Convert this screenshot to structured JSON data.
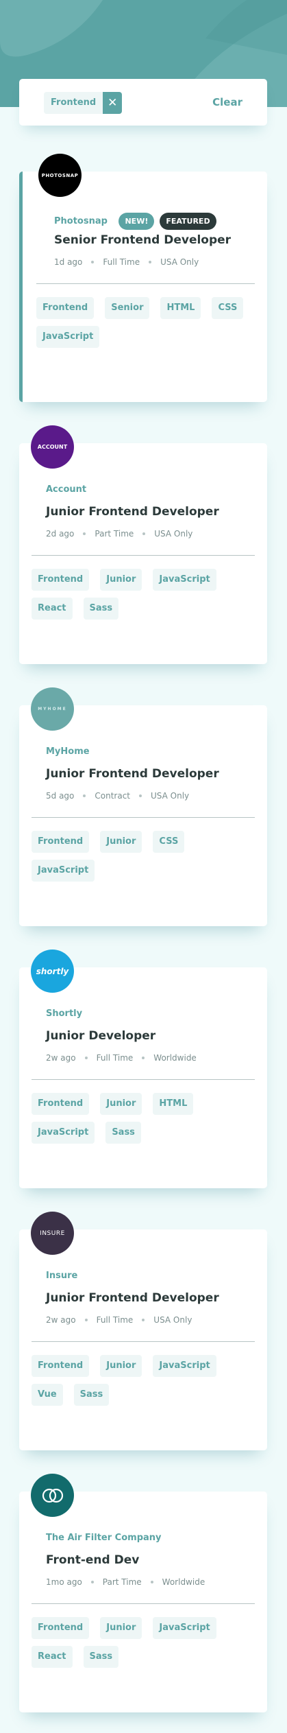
{
  "colors": {
    "primary": "#5ba4a4",
    "bg": "#effafa",
    "dark": "#2c3a3a",
    "gray": "#7b8e8e"
  },
  "filter": {
    "chips": [
      {
        "label": "Frontend",
        "remove_icon": "close-icon"
      }
    ],
    "clear_label": "Clear"
  },
  "jobs": [
    {
      "company": "Photosnap",
      "logo_text": "PHOTOSNAP",
      "new": "NEW!",
      "featured": "FEATURED",
      "position": "Senior Frontend Developer",
      "posted": "1d ago",
      "contract": "Full Time",
      "location": "USA Only",
      "tags": [
        "Frontend",
        "Senior",
        "HTML",
        "CSS",
        "JavaScript"
      ]
    },
    {
      "company": "Account",
      "logo_text": "ACCOUNT",
      "position": "Junior Frontend Developer",
      "posted": "2d ago",
      "contract": "Part Time",
      "location": "USA Only",
      "tags": [
        "Frontend",
        "Junior",
        "JavaScript",
        "React",
        "Sass"
      ]
    },
    {
      "company": "MyHome",
      "logo_text": "MYHOME",
      "position": "Junior Frontend Developer",
      "posted": "5d ago",
      "contract": "Contract",
      "location": "USA Only",
      "tags": [
        "Frontend",
        "Junior",
        "CSS",
        "JavaScript"
      ]
    },
    {
      "company": "Shortly",
      "logo_text": "shortly",
      "position": "Junior Developer",
      "posted": "2w ago",
      "contract": "Full Time",
      "location": "Worldwide",
      "tags": [
        "Frontend",
        "Junior",
        "HTML",
        "JavaScript",
        "Sass"
      ]
    },
    {
      "company": "Insure",
      "logo_text": "INSURE",
      "position": "Junior Frontend Developer",
      "posted": "2w ago",
      "contract": "Full Time",
      "location": "USA Only",
      "tags": [
        "Frontend",
        "Junior",
        "JavaScript",
        "Vue",
        "Sass"
      ]
    },
    {
      "company": "The Air Filter Company",
      "logo_text": "",
      "position": "Front-end Dev",
      "posted": "1mo ago",
      "contract": "Part Time",
      "location": "Worldwide",
      "tags": [
        "Frontend",
        "Junior",
        "JavaScript",
        "React",
        "Sass"
      ]
    }
  ]
}
